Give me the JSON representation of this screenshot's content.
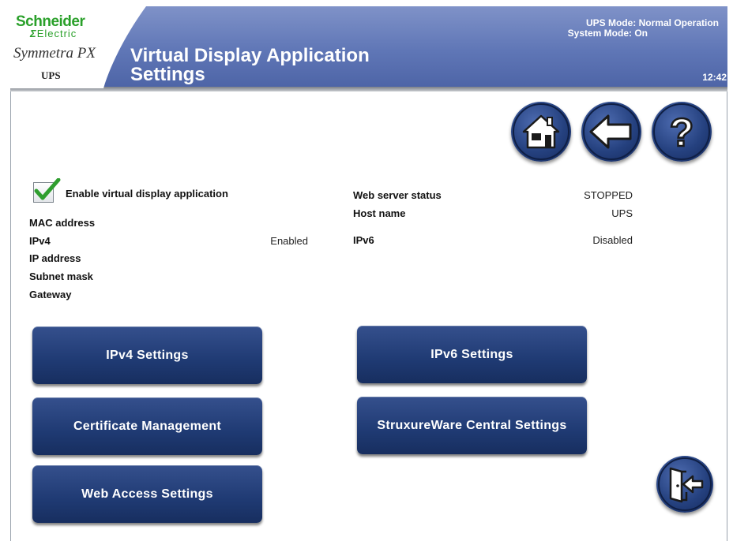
{
  "header": {
    "brand": "Schneider",
    "brand_sub": "Electric",
    "product": "Symmetra PX",
    "product_sub": "UPS",
    "title_line1": "Virtual Display Application",
    "title_line2": "Settings",
    "ups_mode": "UPS Mode: Normal Operation",
    "system_mode": "System Mode: On",
    "time": "12:42"
  },
  "nav": {
    "home_icon": "home-icon",
    "back_icon": "back-arrow-icon",
    "help_icon": "help-icon",
    "logout_icon": "exit-door-icon"
  },
  "enable": {
    "label": "Enable virtual display application",
    "checked": true
  },
  "left_info": {
    "mac_label": "MAC address",
    "ipv4_label": "IPv4",
    "ipv4_value": "Enabled",
    "ip_label": "IP address",
    "subnet_label": "Subnet mask",
    "gateway_label": "Gateway"
  },
  "right_info": {
    "web_status_label": "Web server status",
    "web_status_value": "STOPPED",
    "host_label": "Host name",
    "host_value": "UPS",
    "ipv6_label": "IPv6",
    "ipv6_value": "Disabled"
  },
  "buttons": {
    "ipv4_settings": "IPv4 Settings",
    "ipv6_settings": "IPv6 Settings",
    "certificate_management": "Certificate Management",
    "struxureware_settings": "StruxureWare Central Settings",
    "web_access_settings": "Web Access Settings"
  },
  "colors": {
    "header": "#5f76b6",
    "button": "#1f3a73",
    "brand_green": "#2aa02a",
    "check_green": "#2f9e2f"
  }
}
